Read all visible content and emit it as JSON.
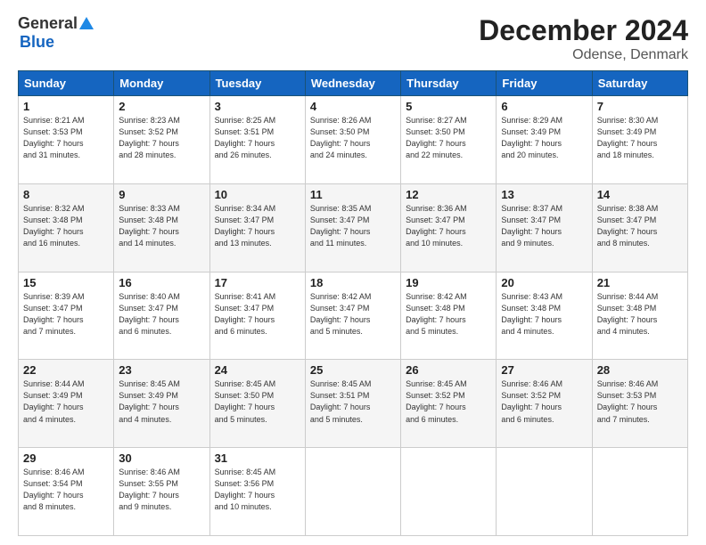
{
  "header": {
    "logo_general": "General",
    "logo_blue": "Blue",
    "title": "December 2024",
    "subtitle": "Odense, Denmark"
  },
  "days_of_week": [
    "Sunday",
    "Monday",
    "Tuesday",
    "Wednesday",
    "Thursday",
    "Friday",
    "Saturday"
  ],
  "weeks": [
    [
      {
        "day": "1",
        "lines": [
          "Sunrise: 8:21 AM",
          "Sunset: 3:53 PM",
          "Daylight: 7 hours",
          "and 31 minutes."
        ]
      },
      {
        "day": "2",
        "lines": [
          "Sunrise: 8:23 AM",
          "Sunset: 3:52 PM",
          "Daylight: 7 hours",
          "and 28 minutes."
        ]
      },
      {
        "day": "3",
        "lines": [
          "Sunrise: 8:25 AM",
          "Sunset: 3:51 PM",
          "Daylight: 7 hours",
          "and 26 minutes."
        ]
      },
      {
        "day": "4",
        "lines": [
          "Sunrise: 8:26 AM",
          "Sunset: 3:50 PM",
          "Daylight: 7 hours",
          "and 24 minutes."
        ]
      },
      {
        "day": "5",
        "lines": [
          "Sunrise: 8:27 AM",
          "Sunset: 3:50 PM",
          "Daylight: 7 hours",
          "and 22 minutes."
        ]
      },
      {
        "day": "6",
        "lines": [
          "Sunrise: 8:29 AM",
          "Sunset: 3:49 PM",
          "Daylight: 7 hours",
          "and 20 minutes."
        ]
      },
      {
        "day": "7",
        "lines": [
          "Sunrise: 8:30 AM",
          "Sunset: 3:49 PM",
          "Daylight: 7 hours",
          "and 18 minutes."
        ]
      }
    ],
    [
      {
        "day": "8",
        "lines": [
          "Sunrise: 8:32 AM",
          "Sunset: 3:48 PM",
          "Daylight: 7 hours",
          "and 16 minutes."
        ]
      },
      {
        "day": "9",
        "lines": [
          "Sunrise: 8:33 AM",
          "Sunset: 3:48 PM",
          "Daylight: 7 hours",
          "and 14 minutes."
        ]
      },
      {
        "day": "10",
        "lines": [
          "Sunrise: 8:34 AM",
          "Sunset: 3:47 PM",
          "Daylight: 7 hours",
          "and 13 minutes."
        ]
      },
      {
        "day": "11",
        "lines": [
          "Sunrise: 8:35 AM",
          "Sunset: 3:47 PM",
          "Daylight: 7 hours",
          "and 11 minutes."
        ]
      },
      {
        "day": "12",
        "lines": [
          "Sunrise: 8:36 AM",
          "Sunset: 3:47 PM",
          "Daylight: 7 hours",
          "and 10 minutes."
        ]
      },
      {
        "day": "13",
        "lines": [
          "Sunrise: 8:37 AM",
          "Sunset: 3:47 PM",
          "Daylight: 7 hours",
          "and 9 minutes."
        ]
      },
      {
        "day": "14",
        "lines": [
          "Sunrise: 8:38 AM",
          "Sunset: 3:47 PM",
          "Daylight: 7 hours",
          "and 8 minutes."
        ]
      }
    ],
    [
      {
        "day": "15",
        "lines": [
          "Sunrise: 8:39 AM",
          "Sunset: 3:47 PM",
          "Daylight: 7 hours",
          "and 7 minutes."
        ]
      },
      {
        "day": "16",
        "lines": [
          "Sunrise: 8:40 AM",
          "Sunset: 3:47 PM",
          "Daylight: 7 hours",
          "and 6 minutes."
        ]
      },
      {
        "day": "17",
        "lines": [
          "Sunrise: 8:41 AM",
          "Sunset: 3:47 PM",
          "Daylight: 7 hours",
          "and 6 minutes."
        ]
      },
      {
        "day": "18",
        "lines": [
          "Sunrise: 8:42 AM",
          "Sunset: 3:47 PM",
          "Daylight: 7 hours",
          "and 5 minutes."
        ]
      },
      {
        "day": "19",
        "lines": [
          "Sunrise: 8:42 AM",
          "Sunset: 3:48 PM",
          "Daylight: 7 hours",
          "and 5 minutes."
        ]
      },
      {
        "day": "20",
        "lines": [
          "Sunrise: 8:43 AM",
          "Sunset: 3:48 PM",
          "Daylight: 7 hours",
          "and 4 minutes."
        ]
      },
      {
        "day": "21",
        "lines": [
          "Sunrise: 8:44 AM",
          "Sunset: 3:48 PM",
          "Daylight: 7 hours",
          "and 4 minutes."
        ]
      }
    ],
    [
      {
        "day": "22",
        "lines": [
          "Sunrise: 8:44 AM",
          "Sunset: 3:49 PM",
          "Daylight: 7 hours",
          "and 4 minutes."
        ]
      },
      {
        "day": "23",
        "lines": [
          "Sunrise: 8:45 AM",
          "Sunset: 3:49 PM",
          "Daylight: 7 hours",
          "and 4 minutes."
        ]
      },
      {
        "day": "24",
        "lines": [
          "Sunrise: 8:45 AM",
          "Sunset: 3:50 PM",
          "Daylight: 7 hours",
          "and 5 minutes."
        ]
      },
      {
        "day": "25",
        "lines": [
          "Sunrise: 8:45 AM",
          "Sunset: 3:51 PM",
          "Daylight: 7 hours",
          "and 5 minutes."
        ]
      },
      {
        "day": "26",
        "lines": [
          "Sunrise: 8:45 AM",
          "Sunset: 3:52 PM",
          "Daylight: 7 hours",
          "and 6 minutes."
        ]
      },
      {
        "day": "27",
        "lines": [
          "Sunrise: 8:46 AM",
          "Sunset: 3:52 PM",
          "Daylight: 7 hours",
          "and 6 minutes."
        ]
      },
      {
        "day": "28",
        "lines": [
          "Sunrise: 8:46 AM",
          "Sunset: 3:53 PM",
          "Daylight: 7 hours",
          "and 7 minutes."
        ]
      }
    ],
    [
      {
        "day": "29",
        "lines": [
          "Sunrise: 8:46 AM",
          "Sunset: 3:54 PM",
          "Daylight: 7 hours",
          "and 8 minutes."
        ]
      },
      {
        "day": "30",
        "lines": [
          "Sunrise: 8:46 AM",
          "Sunset: 3:55 PM",
          "Daylight: 7 hours",
          "and 9 minutes."
        ]
      },
      {
        "day": "31",
        "lines": [
          "Sunrise: 8:45 AM",
          "Sunset: 3:56 PM",
          "Daylight: 7 hours",
          "and 10 minutes."
        ]
      },
      null,
      null,
      null,
      null
    ]
  ]
}
